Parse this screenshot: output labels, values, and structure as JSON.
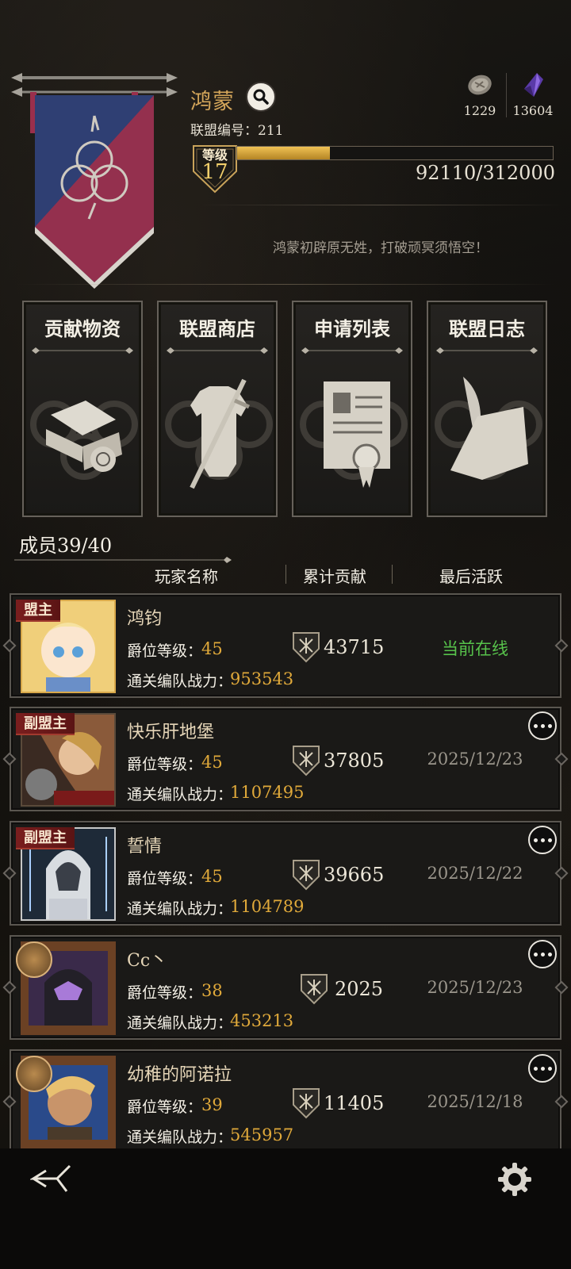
{
  "header": {
    "guild_name": "鸿蒙",
    "guild_id_text": "联盟编号：211",
    "level_label": "等级",
    "level_value": "17",
    "xp_text": "92110/312000",
    "xp_fraction": 0.295,
    "motto": "鸿蒙初辟原无姓，打破顽冥须悟空！"
  },
  "currencies": [
    {
      "icon": "coin-icon",
      "value": "1229"
    },
    {
      "icon": "crystal-icon",
      "value": "13604"
    }
  ],
  "actions": [
    {
      "label": "贡献物资",
      "icon": "scroll-bundle-icon"
    },
    {
      "label": "联盟商店",
      "icon": "armor-sword-icon"
    },
    {
      "label": "申请列表",
      "icon": "certificate-icon"
    },
    {
      "label": "联盟日志",
      "icon": "quill-scroll-icon"
    }
  ],
  "members": {
    "count_text": "成员39/40",
    "columns": [
      "玩家名称",
      "累计贡献",
      "最后活跃"
    ],
    "rank_label": "爵位等级：",
    "power_label": "通关编队战力：",
    "rows": [
      {
        "role": "盟主",
        "name": "鸿钧",
        "rank": "45",
        "power": "953543",
        "contribution": "43715",
        "last_active": "当前在线",
        "online": true
      },
      {
        "role": "副盟主",
        "name": "快乐肝地堡",
        "rank": "45",
        "power": "1107495",
        "contribution": "37805",
        "last_active": "2025/12/23",
        "online": false
      },
      {
        "role": "副盟主",
        "name": "誓情",
        "rank": "45",
        "power": "1104789",
        "contribution": "39665",
        "last_active": "2025/12/22",
        "online": false
      },
      {
        "role": "",
        "name": "Cc丶",
        "rank": "38",
        "power": "453213",
        "contribution": "2025",
        "last_active": "2025/12/23",
        "online": false
      },
      {
        "role": "",
        "name": "幼稚的阿诺拉",
        "rank": "39",
        "power": "545957",
        "contribution": "11405",
        "last_active": "2025/12/18",
        "online": false
      }
    ]
  },
  "colors": {
    "gold": "#e0a93a",
    "online_green": "#57c24b",
    "role_red": "#7a1e1e",
    "banner_blue": "#2f3f73",
    "banner_red": "#9a2f4c"
  }
}
